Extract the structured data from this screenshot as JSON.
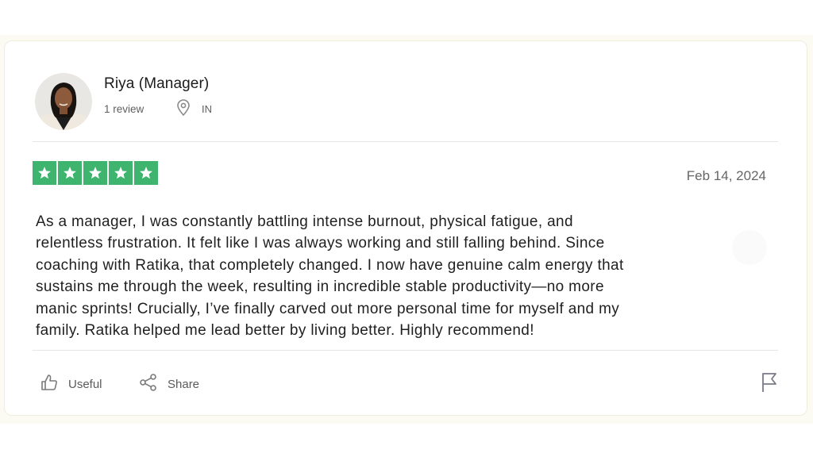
{
  "reviewer": {
    "name": "Riya (Manager)",
    "review_count": "1 review",
    "country": "IN",
    "avatar_icon": "reviewer-avatar"
  },
  "rating": {
    "stars": 5,
    "max_stars": 5,
    "color": "#3fb46e"
  },
  "date": "Feb 14, 2024",
  "review_lines": [
    "As a manager, I was constantly battling intense burnout, physical fatigue, and",
    "relentless frustration. It felt like I was always working and still falling behind. Since",
    "coaching with Ratika, that completely changed. I now have genuine calm energy that",
    "sustains me through the week, resulting in incredible stable productivity—no more",
    "manic sprints! Crucially, I’ve finally carved out more personal time for myself and my",
    "family. Ratika helped me lead better by living better. Highly recommend!"
  ],
  "actions": {
    "useful_label": "Useful",
    "share_label": "Share",
    "useful_icon": "thumbs-up-icon",
    "share_icon": "share-icon",
    "flag_icon": "flag-icon"
  }
}
